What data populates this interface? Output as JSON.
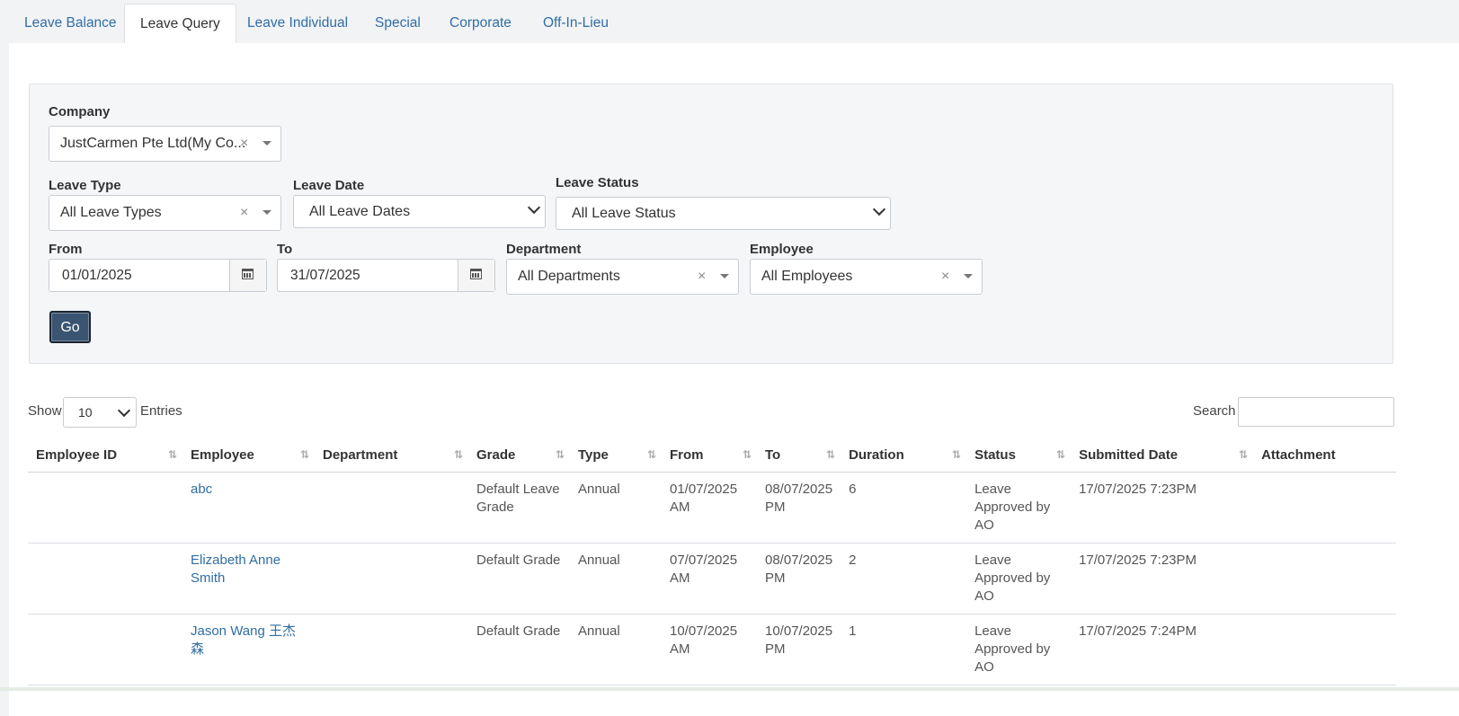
{
  "tabs": [
    {
      "label": "Leave Balance"
    },
    {
      "label": "Leave Query"
    },
    {
      "label": "Leave Individual"
    },
    {
      "label": "Special"
    },
    {
      "label": "Corporate"
    },
    {
      "label": "Off-In-Lieu"
    }
  ],
  "active_tab": "Leave Query",
  "filters": {
    "company": {
      "label": "Company",
      "value": "JustCarmen Pte Ltd(My Co..."
    },
    "leave_type": {
      "label": "Leave Type",
      "value": "All Leave Types"
    },
    "leave_date": {
      "label": "Leave Date",
      "value": "All Leave Dates"
    },
    "leave_status": {
      "label": "Leave Status",
      "value": "All Leave Status"
    },
    "from": {
      "label": "From",
      "value": "01/01/2025"
    },
    "to": {
      "label": "To",
      "value": "31/07/2025"
    },
    "department": {
      "label": "Department",
      "value": "All Departments"
    },
    "employee": {
      "label": "Employee",
      "value": "All Employees"
    },
    "go_label": "Go",
    "clear_glyph": "×"
  },
  "table_controls": {
    "show_label": "Show",
    "page_length": "10",
    "entries_label": "Entries",
    "search_label": "Search"
  },
  "table": {
    "columns": [
      "Employee ID",
      "Employee",
      "Department",
      "Grade",
      "Type",
      "From",
      "To",
      "Duration",
      "Status",
      "Submitted Date",
      "Attachment"
    ],
    "rows": [
      {
        "employee_id": "",
        "employee": "abc",
        "department": "",
        "grade": "Default Leave Grade",
        "type": "Annual",
        "from": "01/07/2025 AM",
        "to": "08/07/2025 PM",
        "duration": "6",
        "status": "Leave Approved by AO",
        "submitted": "17/07/2025 7:23PM",
        "attachment": ""
      },
      {
        "employee_id": "",
        "employee": "Elizabeth Anne Smith",
        "department": "",
        "grade": "Default Grade",
        "type": "Annual",
        "from": "07/07/2025 AM",
        "to": "08/07/2025 PM",
        "duration": "2",
        "status": "Leave Approved by AO",
        "submitted": "17/07/2025 7:23PM",
        "attachment": ""
      },
      {
        "employee_id": "",
        "employee": "Jason Wang 王杰森",
        "department": "",
        "grade": "Default Grade",
        "type": "Annual",
        "from": "10/07/2025 AM",
        "to": "10/07/2025 PM",
        "duration": "1",
        "status": "Leave Approved by AO",
        "submitted": "17/07/2025 7:24PM",
        "attachment": ""
      }
    ]
  },
  "icons": {
    "calendar": "calendar-icon",
    "sort": "sort-icon",
    "dropdown": "caret-down-icon"
  }
}
